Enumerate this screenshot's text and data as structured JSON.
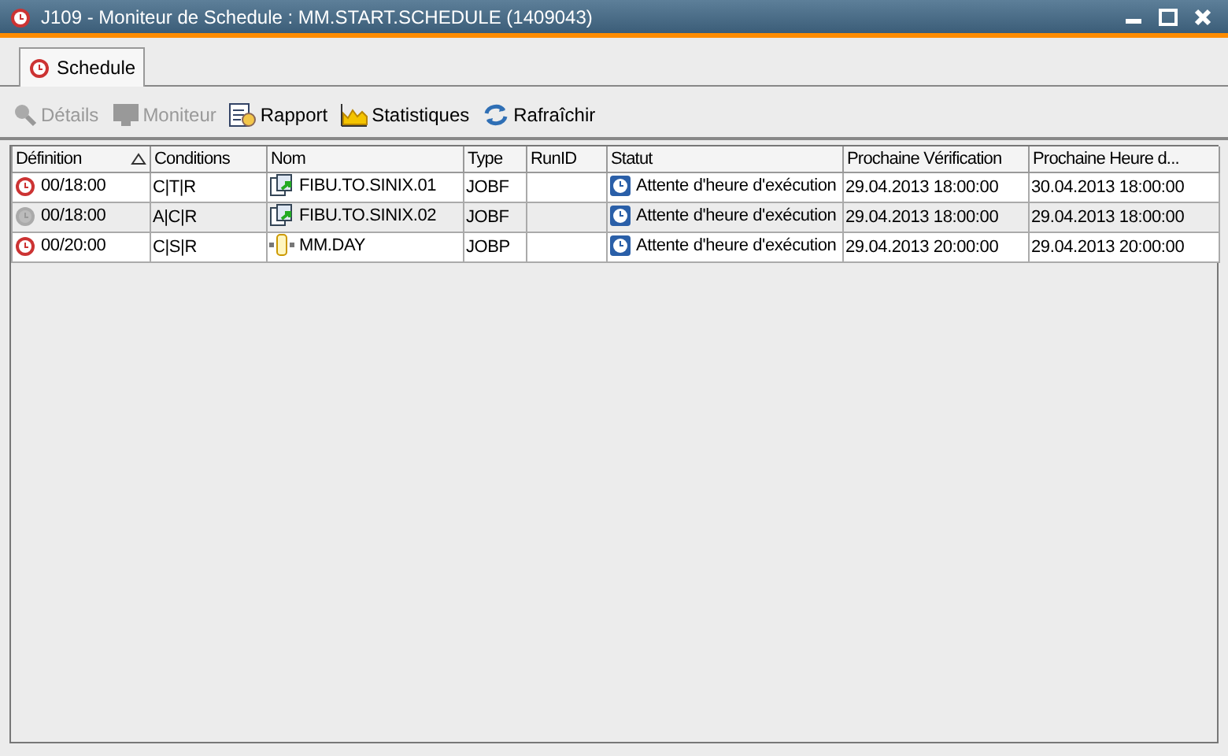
{
  "window": {
    "title": "J109 - Moniteur de Schedule : MM.START.SCHEDULE (1409043)"
  },
  "tabs": [
    {
      "label": "Schedule",
      "selected": true
    }
  ],
  "toolbar": [
    {
      "label": "Détails",
      "kind": "details",
      "disabled": true
    },
    {
      "label": "Moniteur",
      "kind": "monitor",
      "disabled": true
    },
    {
      "label": "Rapport",
      "kind": "report",
      "disabled": false
    },
    {
      "label": "Statistiques",
      "kind": "stats",
      "disabled": false
    },
    {
      "label": "Rafraîchir",
      "kind": "refresh",
      "disabled": false
    }
  ],
  "table": {
    "columns": [
      {
        "label": "Définition",
        "sorted": true
      },
      {
        "label": "Conditions",
        "sorted": false
      },
      {
        "label": "Nom",
        "sorted": false
      },
      {
        "label": "Type",
        "sorted": false
      },
      {
        "label": "RunID",
        "sorted": false
      },
      {
        "label": "Statut",
        "sorted": false
      },
      {
        "label": "Prochaine Vérification",
        "sorted": false
      },
      {
        "label": "Prochaine Heure d...",
        "sorted": false
      }
    ],
    "rows": [
      {
        "definition": "00/18:00",
        "active": true,
        "conditions": "C|T|R",
        "name": "FIBU.TO.SINIX.01",
        "kind": "jobf",
        "type": "JOBF",
        "status": "Attente d'heure d'exécution",
        "next_check": "29.04.2013 18:00:00",
        "next_time": "30.04.2013 18:00:00"
      },
      {
        "definition": "00/18:00",
        "active": false,
        "conditions": "A|C|R",
        "name": "FIBU.TO.SINIX.02",
        "kind": "jobf",
        "type": "JOBF",
        "status": "Attente d'heure d'exécution",
        "next_check": "29.04.2013 18:00:00",
        "next_time": "29.04.2013 18:00:00"
      },
      {
        "definition": "00/20:00",
        "active": true,
        "conditions": "C|S|R",
        "name": "MM.DAY",
        "kind": "jobp",
        "type": "JOBP",
        "status": "Attente d'heure d'exécution",
        "next_check": "29.04.2013 20:00:00",
        "next_time": "29.04.2013 20:00:00"
      }
    ]
  }
}
